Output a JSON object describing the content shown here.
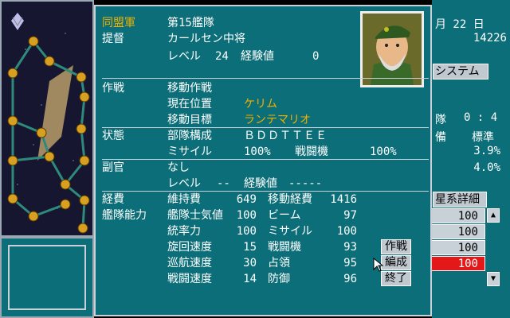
{
  "right_panel": {
    "date_month": "月 22 日",
    "money": "14226",
    "system_button": "システム",
    "fleet_label": "隊",
    "fleet_value": "0 : 4",
    "equip_label": "備",
    "equip_value": "標準",
    "pct1": "3.9%",
    "pct2": "4.0%",
    "galaxy_detail_button": "星系詳細",
    "slider_values": [
      "100",
      "100",
      "100",
      "100"
    ]
  },
  "fleet": {
    "faction": "同盟軍",
    "fleet_name": "第15艦隊",
    "admiral_label": "提督",
    "admiral_name": "カールセン中将",
    "level_label": "レベル",
    "level": "24",
    "exp_label": "経験値",
    "exp": "0"
  },
  "operation": {
    "label": "作戦",
    "type": "移動作戦",
    "current_pos_label": "現在位置",
    "current_pos": "ケリム",
    "target_label": "移動目標",
    "target": "ランテマリオ"
  },
  "status": {
    "label": "状態",
    "composition_label": "部隊構成",
    "composition": "ＢＤＤＴＴＥＥ",
    "missile_label": "ミサイル",
    "missile": "100%",
    "fighter_label": "戦闘機",
    "fighter": "100%"
  },
  "adjutant": {
    "label": "副官",
    "name": "なし",
    "level_label": "レベル",
    "level": "--",
    "exp_label": "経験値",
    "exp": "-----"
  },
  "cost": {
    "label": "経費",
    "upkeep_label": "維持費",
    "upkeep": "649",
    "move_cost_label": "移動経費",
    "move_cost": "1416"
  },
  "ability": {
    "label": "艦隊能力",
    "rows": [
      {
        "a_label": "艦隊士気値",
        "a_value": "100",
        "b_label": "ビーム",
        "b_value": "97"
      },
      {
        "a_label": "統率力",
        "a_value": "100",
        "b_label": "ミサイル",
        "b_value": "100"
      },
      {
        "a_label": "旋回速度",
        "a_value": "15",
        "b_label": "戦闘機",
        "b_value": "93"
      },
      {
        "a_label": "巡航速度",
        "a_value": "30",
        "b_label": "占領",
        "b_value": "95"
      },
      {
        "a_label": "戦闘速度",
        "a_value": "14",
        "b_label": "防御",
        "b_value": "96"
      }
    ]
  },
  "commands": {
    "operation": "作戦",
    "formation": "編成",
    "end": "終了"
  }
}
